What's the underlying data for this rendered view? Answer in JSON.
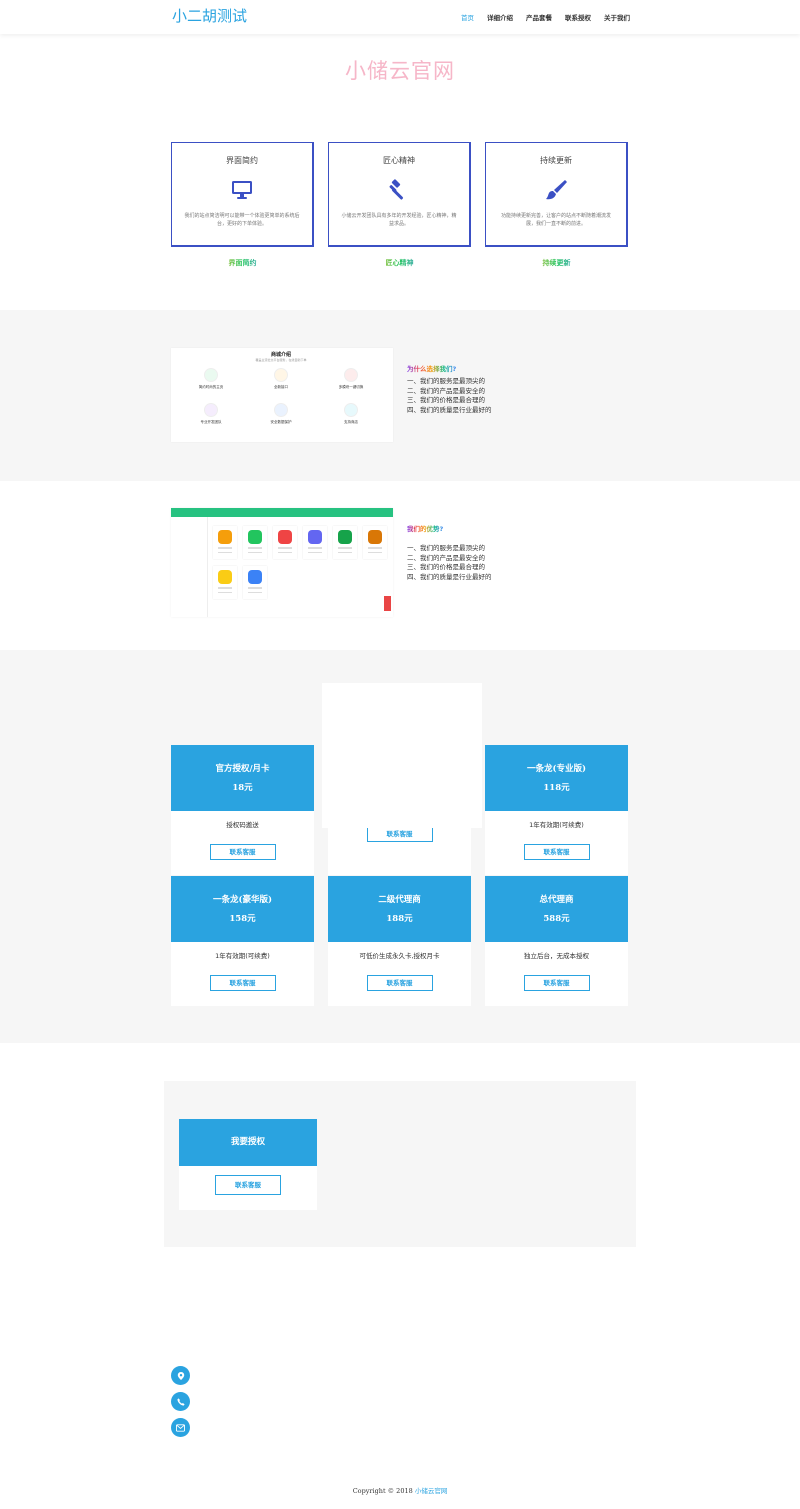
{
  "header": {
    "brand": "小二胡测试",
    "nav": [
      "首页",
      "详细介绍",
      "产品套餐",
      "联系授权",
      "关于我们"
    ]
  },
  "hero": {
    "title": "小储云官网"
  },
  "features": [
    {
      "title": "界面简约",
      "icon": "monitor-icon",
      "desc": "我们的站点简洁明可以能带一个体验更简单的系统后台，更好的下单体验。",
      "tag": "界面简约"
    },
    {
      "title": "匠心精神",
      "icon": "gavel-icon",
      "desc": "小储云开发团队具有多年的开发经验，匠心精神，精益求品。",
      "tag": "匠心精神"
    },
    {
      "title": "持续更新",
      "icon": "brush-icon",
      "desc": "功能持续更新完善，让客户的站点不断随着潮流发展，我们一直不断的前进。",
      "tag": "持续更新"
    }
  ],
  "why1": {
    "title": "为什么选择我们?",
    "items": [
      "一、我们的服务是最顶尖的",
      "二、我们的产品是最安全的",
      "三、我们的价格是最合理的",
      "四、我们的质量是行业最好的"
    ],
    "shot": {
      "title": "商城介绍",
      "subtitle": "覆盖主流社交平台服务，在线自助下单",
      "modules": [
        {
          "t": "简约时尚的主页",
          "c": "#22c55e"
        },
        {
          "t": "全新接口",
          "c": "#f59e0b"
        },
        {
          "t": "多模块一键切换",
          "c": "#ef4444"
        },
        {
          "t": "专业开发团队",
          "c": "#a855f7"
        },
        {
          "t": "安全数据保护",
          "c": "#3b82f6"
        },
        {
          "t": "支持商店",
          "c": "#06b6d4"
        }
      ]
    }
  },
  "why2": {
    "title": "我们的优势?",
    "items": [
      "一、我们的服务是最顶尖的",
      "二、我们的产品是最安全的",
      "三、我们的价格是最合理的",
      "四、我们的质量是行业最好的"
    ]
  },
  "pricing": [
    {
      "name": "官方授权/月卡",
      "price": "18元",
      "desc": "授权码邀送",
      "button": "联系客服"
    },
    {
      "name": "",
      "price": "",
      "desc": "",
      "button": "联系客服"
    },
    {
      "name": "一条龙(专业版)",
      "price": "118元",
      "desc": "1年有效期(可续费)",
      "button": "联系客服"
    },
    {
      "name": "一条龙(豪华版)",
      "price": "158元",
      "desc": "1年有效期(可续费)",
      "button": "联系客服"
    },
    {
      "name": "二级代理商",
      "price": "188元",
      "desc": "可低价生成永久卡,授权月卡",
      "button": "联系客服"
    },
    {
      "name": "总代理商",
      "price": "588元",
      "desc": "独立后台，无成本授权",
      "button": "联系客服"
    }
  ],
  "authorize": {
    "title": "我要授权",
    "button": "联系客服"
  },
  "contacts": [
    "location-icon",
    "phone-icon",
    "mail-icon"
  ],
  "footer": {
    "prefix": "Copyright © 2018",
    "link": "小储云官网"
  },
  "colors": {
    "accent": "#2aa3e0",
    "card_border": "#3b50c4",
    "band": "#f6f6f6"
  }
}
